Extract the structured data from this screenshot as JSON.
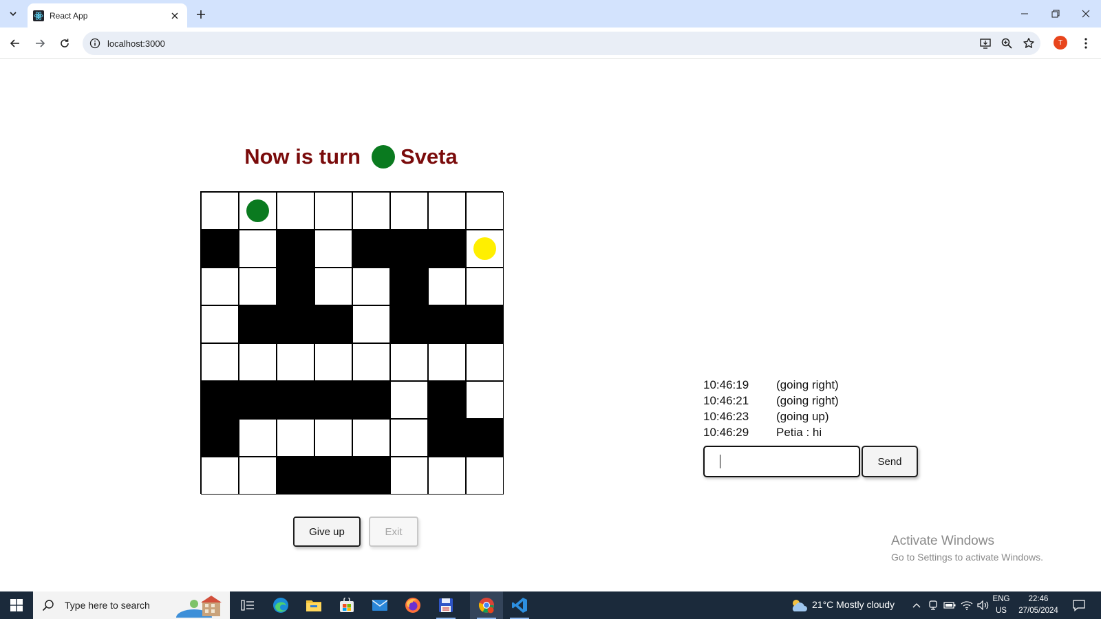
{
  "browser": {
    "tab_title": "React App",
    "url": "localhost:3000",
    "profile_initial": "T"
  },
  "game": {
    "turn_prefix": "Now is turn",
    "current_player": "Sveta",
    "current_player_color": "#0a7a1f",
    "board": [
      "........",
      "#.#.###.",
      "..#..#..",
      ".###.###",
      "........",
      "#####.#.",
      "#.....##",
      "..###..."
    ],
    "tokens": [
      {
        "row": 0,
        "col": 1,
        "color": "#0a7a1f",
        "icon": "green-player-token"
      },
      {
        "row": 1,
        "col": 7,
        "color": "#ffef00",
        "icon": "yellow-player-token"
      }
    ],
    "give_up_label": "Give up",
    "exit_label": "Exit"
  },
  "chat": {
    "messages": [
      {
        "time": "10:46:19",
        "text": "(going right)"
      },
      {
        "time": "10:46:21",
        "text": "(going right)"
      },
      {
        "time": "10:46:23",
        "text": "(going up)"
      },
      {
        "time": "10:46:29",
        "text": "Petia : hi"
      }
    ],
    "input_value": "",
    "send_label": "Send"
  },
  "watermark": {
    "title": "Activate Windows",
    "subtitle": "Go to Settings to activate Windows."
  },
  "taskbar": {
    "search_placeholder": "Type here to search",
    "weather": "21°C  Mostly cloudy",
    "lang_line1": "ENG",
    "lang_line2": "US",
    "time": "22:46",
    "date": "27/05/2024"
  }
}
